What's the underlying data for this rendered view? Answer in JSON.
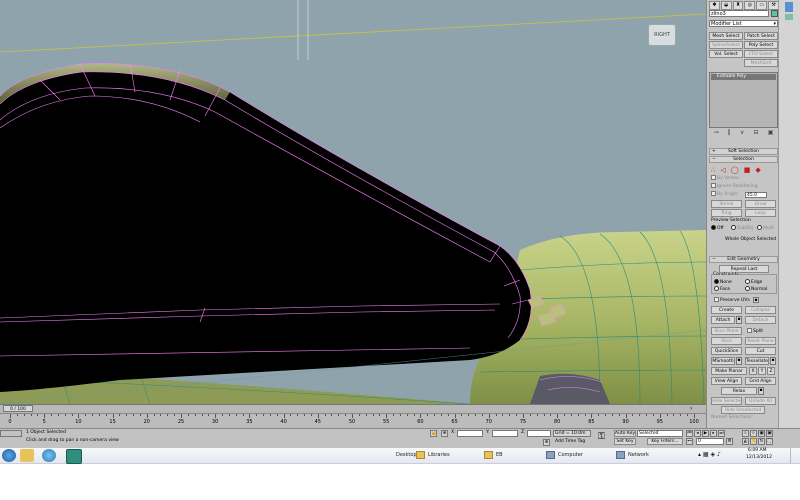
{
  "viewport": {
    "viewcube_label": "RIGHT"
  },
  "command_panel": {
    "object_name": "zlino3",
    "modifier_list": "Modifier List",
    "buttons": {
      "mesh_select": "Mesh Select",
      "patch_select": "Patch Select",
      "spline_select": "SplineSelect",
      "poly_select": "Poly Select",
      "vol_select": "Vol. Select",
      "ffd_select": "FFD Select",
      "meshsmooth": "MeshSmt"
    },
    "stack_item": "Editable Poly",
    "rollouts": {
      "soft_selection": "Soft Selection",
      "selection": "Selection",
      "edit_geometry": "Edit Geometry"
    },
    "selection": {
      "by_vertex": "By Vertex",
      "ignore_backfacing": "Ignore Backfacing",
      "by_angle": "By Angle:",
      "angle_value": "45.0",
      "shrink": "Shrink",
      "grow": "Grow",
      "ring": "Ring",
      "loop": "Loop",
      "preview_selection": "Preview Selection",
      "off": "Off",
      "subobj": "SubObj",
      "multi": "Multi",
      "whole_object": "Whole Object Selected"
    },
    "edit_geometry": {
      "repeat_last": "Repeat Last",
      "constraints": "Constraints",
      "none": "None",
      "edge": "Edge",
      "face": "Face",
      "normal": "Normal",
      "preserve_uvs": "Preserve UVs",
      "create": "Create",
      "collapse": "Collapse",
      "attach": "Attach",
      "detach": "Detach",
      "slice_plane": "Slice Plane",
      "split": "Split",
      "slice": "Slice",
      "reset_plane": "Reset Plane",
      "quickslice": "QuickSlice",
      "cut": "Cut",
      "msmooth": "MSmooth",
      "tessellate": "Tessellate",
      "make_planar": "Make Planar",
      "x": "X",
      "y": "Y",
      "z": "Z",
      "view_align": "View Align",
      "grid_align": "Grid Align",
      "relax": "Relax",
      "hide_selected": "Hide Selected",
      "unhide_all": "Unhide All",
      "hide_unselected": "Hide Unselected",
      "named_selections": "Named Selections:"
    }
  },
  "timeline": {
    "frame_indicator": "0 / 100",
    "ticks": [
      "0",
      "5",
      "10",
      "15",
      "20",
      "25",
      "30",
      "35",
      "40",
      "45",
      "50",
      "55",
      "60",
      "65",
      "70",
      "75",
      "80",
      "85",
      "90",
      "95",
      "100"
    ]
  },
  "status": {
    "selection_text": "1 Object Selected",
    "prompt_text": "Click and drag to pan a non-camera view",
    "x_label": "X:",
    "y_label": "Y:",
    "z_label": "Z:",
    "grid": "Grid = 10.0m",
    "add_time_tag": "Add Time Tag",
    "auto_key": "Auto Key",
    "auto_key_mode": "Selected",
    "set_key": "Set Key",
    "key_filters": "Key Filters...",
    "frame_value": "0"
  },
  "taskbar": {
    "desktop": "Desktop",
    "libraries": "Libraries",
    "folder": "EB",
    "computer": "Computer",
    "network": "Network",
    "time": "6:09 AM",
    "date": "12/13/2012"
  },
  "colors": {
    "viewport_bg": "#8fa3ad",
    "mesh_black": "#000000",
    "wire_selected": "#ff80ff",
    "fuselage": "#a8b86a",
    "accent_teal": "#57c4a0"
  }
}
